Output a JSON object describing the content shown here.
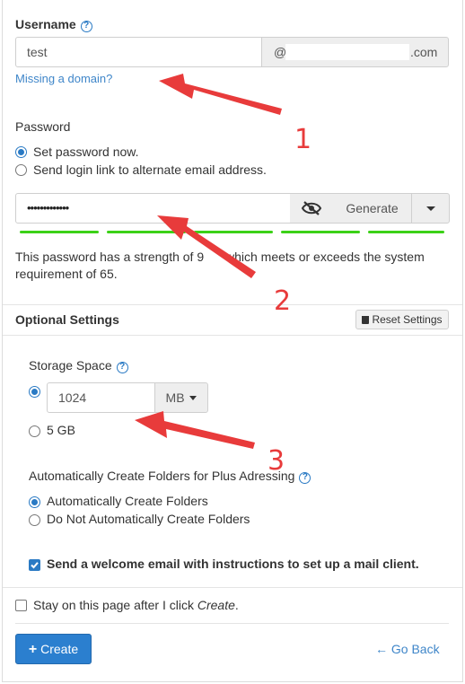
{
  "username": {
    "label": "Username",
    "value": "test",
    "domain_prefix": "@",
    "domain_suffix": ".com",
    "missing_domain_link": "Missing a domain?"
  },
  "password": {
    "label": "Password",
    "option_set_now": "Set password now.",
    "option_send_link": "Send login link to alternate email address.",
    "masked_value": "•••••••••••••",
    "generate_label": "Generate",
    "strength_text": "This password has a strength of 9",
    "strength_text_2": " which meets or exceeds the system",
    "strength_text_3": "requirement of 65."
  },
  "optional_settings": {
    "title": "Optional Settings",
    "reset_label": "Reset Settings"
  },
  "storage": {
    "label": "Storage Space",
    "value": "1024",
    "unit": "MB",
    "option_5gb": "5 GB"
  },
  "plus_addressing": {
    "label": "Automatically Create Folders for Plus Addressing",
    "label_visible_start": "Automatically Create Folders for Plus A",
    "label_visible_end": "dressing",
    "option_auto": "Automatically Create Folders",
    "option_no_auto": "Do Not Automatically Create Folders"
  },
  "welcome_email": {
    "label": "Send a welcome email with instructions to set up a mail client."
  },
  "footer": {
    "stay_text": "Stay on this page after I click ",
    "stay_text_em": "Create",
    "stay_text_end": ".",
    "create_label": "Create",
    "go_back_label": "Go Back"
  },
  "annotations": {
    "n1": "1",
    "n2": "2",
    "n3": "3",
    "arrow_color": "#e83b3b"
  },
  "colors": {
    "accent": "#2a7ac4",
    "strength": "#3bd117",
    "primary_button": "#2b7fcf"
  }
}
